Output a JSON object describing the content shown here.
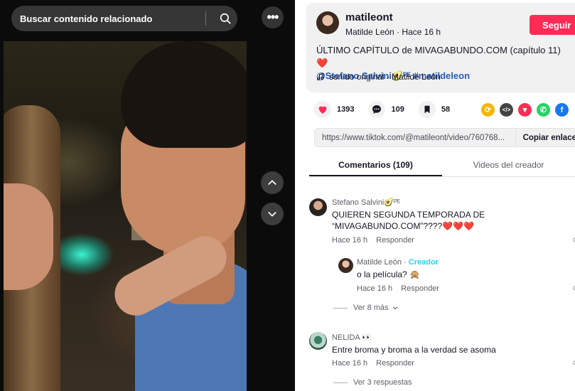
{
  "search": {
    "placeholder": "Buscar contenido relacionado"
  },
  "video": {
    "more_label": "•••"
  },
  "author": {
    "username": "matileont",
    "display_name": "Matilde León",
    "time_ago": "Hace 16 h",
    "follow_label": "Seguir"
  },
  "caption": {
    "text": "ÚLTIMO CAPÍTULO de MIVAGABUNDO.COM (capítulo 11) ❤️",
    "mention": "@Stefano Salvini🥑ᴾᴱ",
    "hashtag": "#matildeleon"
  },
  "sound": {
    "label": "sonido original - Matilde León"
  },
  "stats": {
    "likes": "1393",
    "comments": "109",
    "saves": "58"
  },
  "share": {
    "url": "https://www.tiktok.com/@matileont/video/760768...",
    "copy_label": "Copiar enlace"
  },
  "tabs": [
    {
      "label": "Comentarios (109)"
    },
    {
      "label": "Videos del creador"
    }
  ],
  "comments": [
    {
      "name": "Stefano Salvini🥑ᴾᴱ",
      "text_line1": "QUIEREN SEGUNDA TEMPORADA DE",
      "text_line2": "“MIVAGABUNDO.COM”????❤️❤️❤️",
      "time": "Hace 16 h",
      "reply_label": "Responder"
    },
    {
      "name": "Matilde León",
      "badge": "Creador",
      "text": "o la película? 🙊",
      "time": "Hace 16 h",
      "reply_label": "Responder"
    },
    {
      "name": "NELIDA 👀",
      "text": "Entre broma y broma a la verdad se asoma",
      "time": "Hace 16 h",
      "reply_label": "Responder"
    }
  ],
  "more_replies_1": "Ver 8 más",
  "more_replies_2": "Ver 3 respuestas",
  "colors": {
    "accent": "#fe2c55",
    "link": "#2b5db9",
    "creator": "#20d5ec"
  }
}
